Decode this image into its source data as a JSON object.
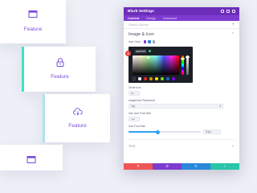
{
  "cards": [
    {
      "label": "Feature",
      "icon": "browser-window-icon"
    },
    {
      "label": "Feature",
      "icon": "lock-icon"
    },
    {
      "label": "Feature",
      "icon": "cloud-download-icon"
    },
    {
      "label": "",
      "icon": "browser-window-icon"
    }
  ],
  "panel": {
    "title": "Blurb Settings",
    "tabs": [
      "Content",
      "Design",
      "Advanced"
    ],
    "active_tab": "Content",
    "search_placeholder": "Search Options"
  },
  "section": {
    "title": "Image & Icon",
    "icon_color_label": "Icon Color",
    "hex_value": "#a42b00",
    "palette_badge": "1",
    "swatch_colors": [
      "#000000",
      "#ffffff",
      "#e02b20",
      "#e09900",
      "#edf000",
      "#7cda24",
      "#0c71c3",
      "#8300e9"
    ]
  },
  "controls": {
    "circle_icon_label": "Circle Icon",
    "circle_icon_value": "No",
    "placement_label": "Image/Icon Placement",
    "placement_value": "Top",
    "font_size_toggle_label": "Use Icon Font Size",
    "font_size_toggle_value": "Yes",
    "font_size_label": "Icon Font Size",
    "font_size_value": "64px",
    "font_size_fraction": 0.4
  },
  "text_section": {
    "title": "Text"
  },
  "footer": {
    "buttons": [
      {
        "name": "cancel",
        "symbol": "✕",
        "color": "#ef5555"
      },
      {
        "name": "undo",
        "symbol": "↺",
        "color": "#7e3bd0"
      },
      {
        "name": "redo",
        "symbol": "↻",
        "color": "#2b87da"
      },
      {
        "name": "save",
        "symbol": "✓",
        "color": "#29c4a9"
      }
    ]
  },
  "colors": {
    "accent_purple": "#7a4ddb",
    "header_purple": "#6c2eb9",
    "card_highlight": "#3ce3c5"
  }
}
